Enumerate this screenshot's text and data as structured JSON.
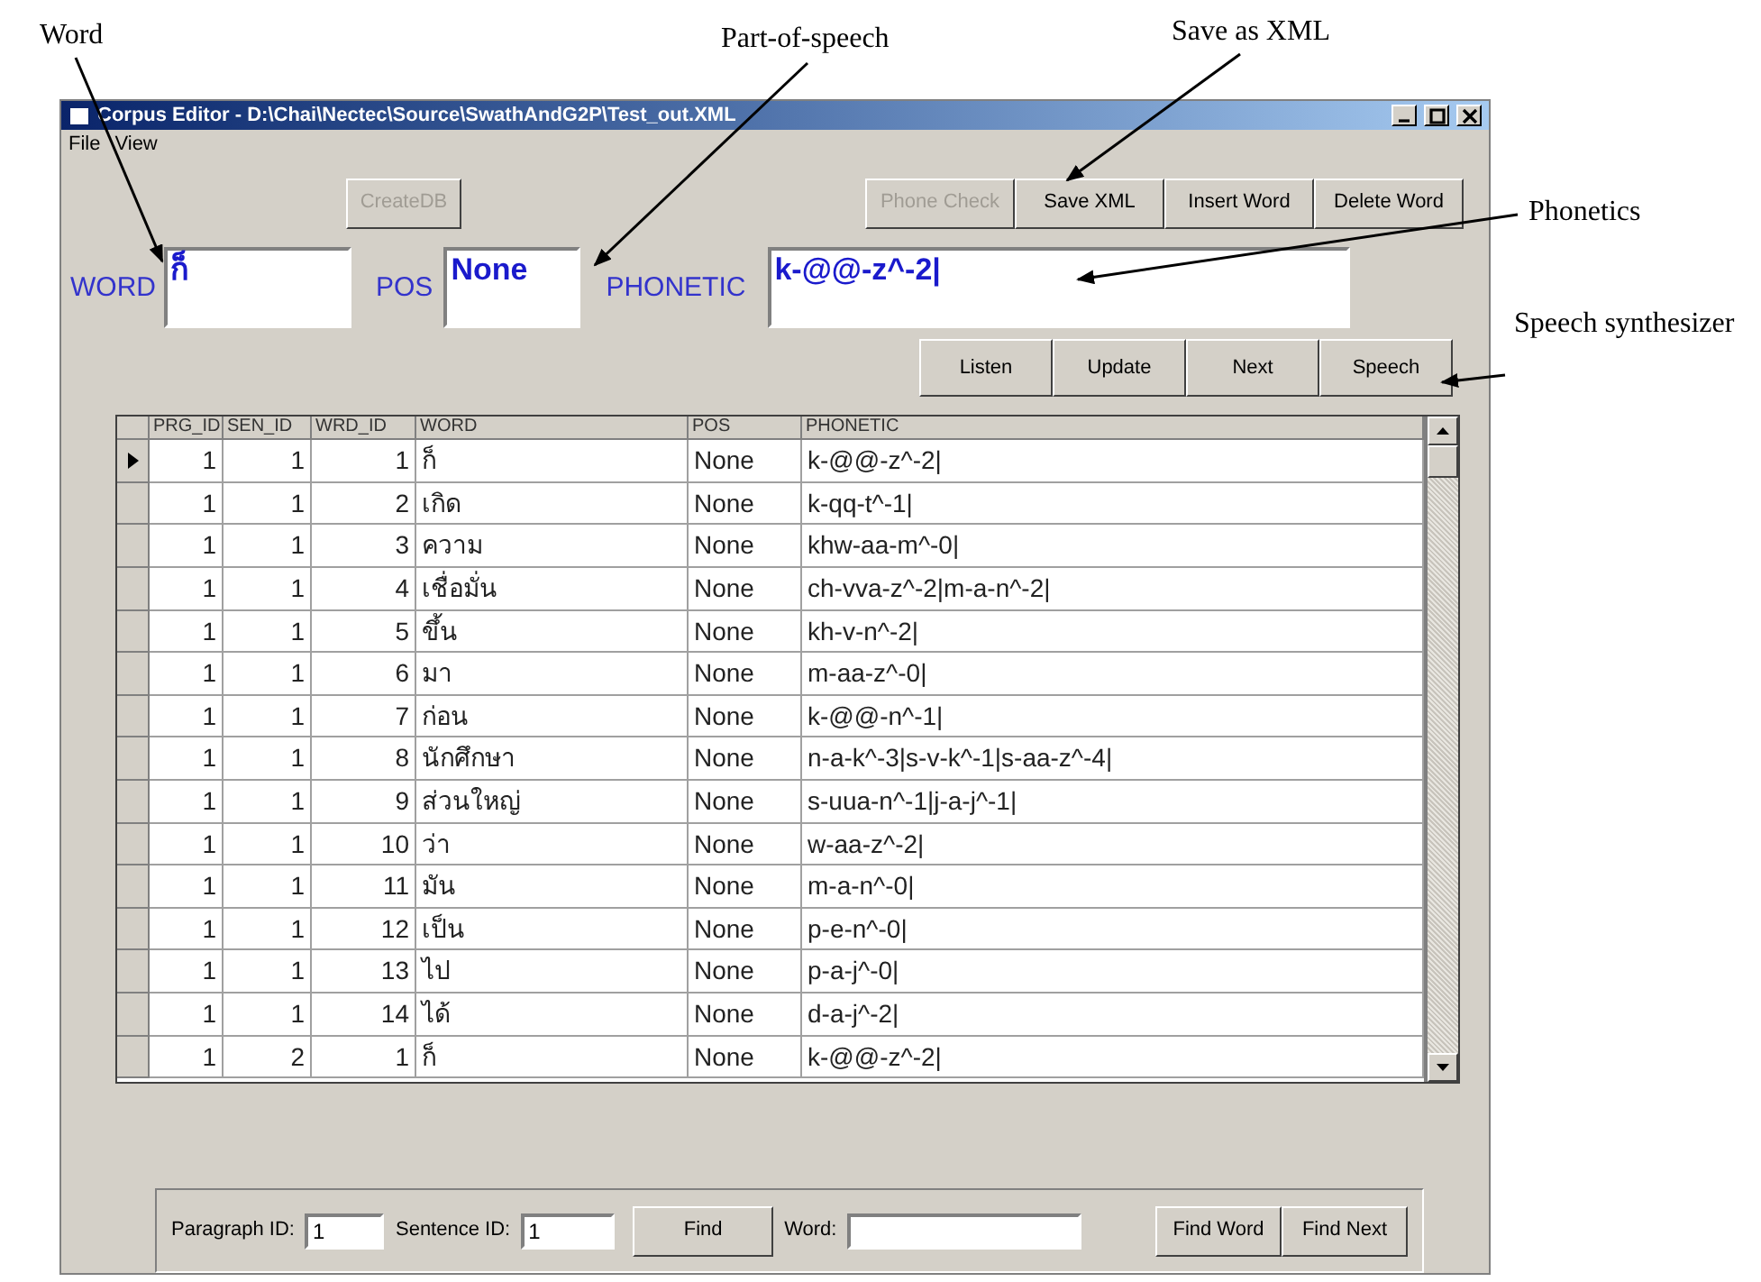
{
  "callouts": [
    {
      "label": "Word"
    },
    {
      "label": "Part-of-speech"
    },
    {
      "label": "Save as XML"
    },
    {
      "label": "Phonetics"
    },
    {
      "label": "Speech synthesizer"
    }
  ],
  "window": {
    "title": "Corpus Editor - D:\\Chai\\Nectec\\Source\\SwathAndG2P\\Test_out.XML"
  },
  "menu": [
    "File",
    "View"
  ],
  "top_buttons": [
    {
      "label": "CreateDB",
      "disabled": true
    }
  ],
  "action_buttons": [
    {
      "label": "Phone Check",
      "disabled": true
    },
    {
      "label": "Save XML",
      "disabled": false
    },
    {
      "label": "Insert Word",
      "disabled": false
    },
    {
      "label": "Delete Word",
      "disabled": false
    }
  ],
  "fields": [
    {
      "label": "WORD",
      "value": "ก็"
    },
    {
      "label": "POS",
      "value": "None"
    },
    {
      "label": "PHONETIC",
      "value": "k-@@-z^-2|"
    }
  ],
  "edit_buttons": [
    "Listen",
    "Update",
    "Next",
    "Speech"
  ],
  "table": {
    "columns": [
      "PRG_ID",
      "SEN_ID",
      "WRD_ID",
      "WORD",
      "POS",
      "PHONETIC"
    ],
    "rows": [
      {
        "selected": true,
        "cells": [
          "1",
          "1",
          "1",
          "ก็",
          "None",
          "k-@@-z^-2|"
        ]
      },
      {
        "selected": false,
        "cells": [
          "1",
          "1",
          "2",
          "เกิด",
          "None",
          "k-qq-t^-1|"
        ]
      },
      {
        "selected": false,
        "cells": [
          "1",
          "1",
          "3",
          "ความ",
          "None",
          "khw-aa-m^-0|"
        ]
      },
      {
        "selected": false,
        "cells": [
          "1",
          "1",
          "4",
          "เชื่อมั่น",
          "None",
          "ch-vva-z^-2|m-a-n^-2|"
        ]
      },
      {
        "selected": false,
        "cells": [
          "1",
          "1",
          "5",
          "ขึ้น",
          "None",
          "kh-v-n^-2|"
        ]
      },
      {
        "selected": false,
        "cells": [
          "1",
          "1",
          "6",
          "มา",
          "None",
          "m-aa-z^-0|"
        ]
      },
      {
        "selected": false,
        "cells": [
          "1",
          "1",
          "7",
          "ก่อน",
          "None",
          "k-@@-n^-1|"
        ]
      },
      {
        "selected": false,
        "cells": [
          "1",
          "1",
          "8",
          "นักศึกษา",
          "None",
          "n-a-k^-3|s-v-k^-1|s-aa-z^-4|"
        ]
      },
      {
        "selected": false,
        "cells": [
          "1",
          "1",
          "9",
          "ส่วนใหญ่",
          "None",
          "s-uua-n^-1|j-a-j^-1|"
        ]
      },
      {
        "selected": false,
        "cells": [
          "1",
          "1",
          "10",
          "ว่า",
          "None",
          "w-aa-z^-2|"
        ]
      },
      {
        "selected": false,
        "cells": [
          "1",
          "1",
          "11",
          "มัน",
          "None",
          "m-a-n^-0|"
        ]
      },
      {
        "selected": false,
        "cells": [
          "1",
          "1",
          "12",
          "เป็น",
          "None",
          "p-e-n^-0|"
        ]
      },
      {
        "selected": false,
        "cells": [
          "1",
          "1",
          "13",
          "ไป",
          "None",
          "p-a-j^-0|"
        ]
      },
      {
        "selected": false,
        "cells": [
          "1",
          "1",
          "14",
          "ได้",
          "None",
          "d-a-j^-2|"
        ]
      },
      {
        "selected": false,
        "cells": [
          "1",
          "2",
          "1",
          "ก็",
          "None",
          "k-@@-z^-2|"
        ]
      }
    ]
  },
  "search": {
    "paragraph_label": "Paragraph ID:",
    "paragraph_value": "1",
    "sentence_label": "Sentence ID:",
    "sentence_value": "1",
    "find_button": "Find",
    "word_label": "Word:",
    "buttons": [
      "Find Word",
      "Find Next"
    ]
  }
}
